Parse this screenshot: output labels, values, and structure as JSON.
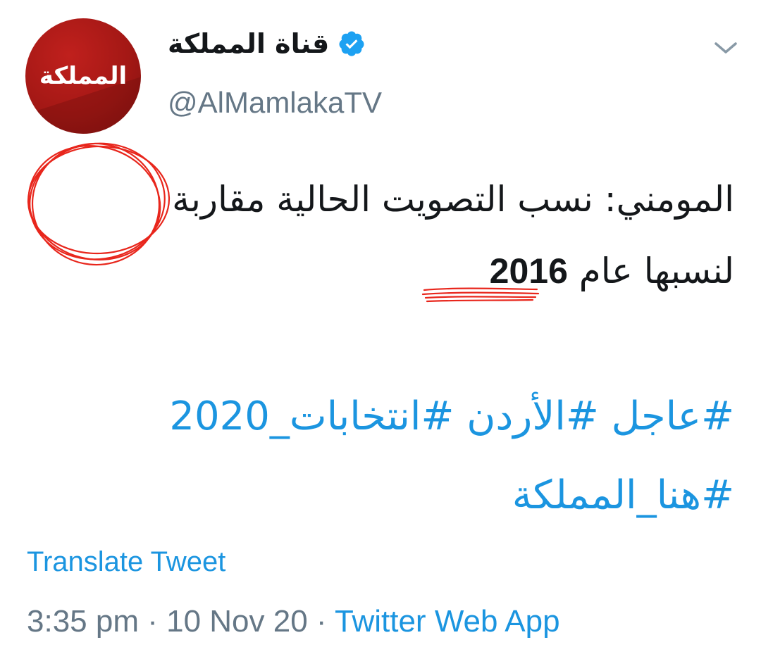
{
  "account": {
    "display_name": "قناة المملكة",
    "handle": "@AlMamlakaTV",
    "avatar_text": "المملكة"
  },
  "tweet": {
    "line1_part1": "المومني: نسب التصويت الحالية",
    "line1_circled": "مقاربة",
    "line2_text": "لنسبها عام",
    "line2_year": "2016"
  },
  "hashtags": {
    "tag1": "#عاجل",
    "tag2": "#الأردن",
    "tag3": "#انتخابات_2020",
    "tag4": "#هنا_المملكة"
  },
  "translate_label": "Translate Tweet",
  "meta": {
    "time": "3:35 pm",
    "date": "10 Nov 20",
    "separator": "·",
    "source": "Twitter Web App"
  },
  "colors": {
    "link": "#1b95e0",
    "muted": "#657786",
    "annotation": "#e8261c",
    "avatar": "#a41815"
  },
  "icons": [
    "verified-badge-icon",
    "chevron-down-icon"
  ]
}
